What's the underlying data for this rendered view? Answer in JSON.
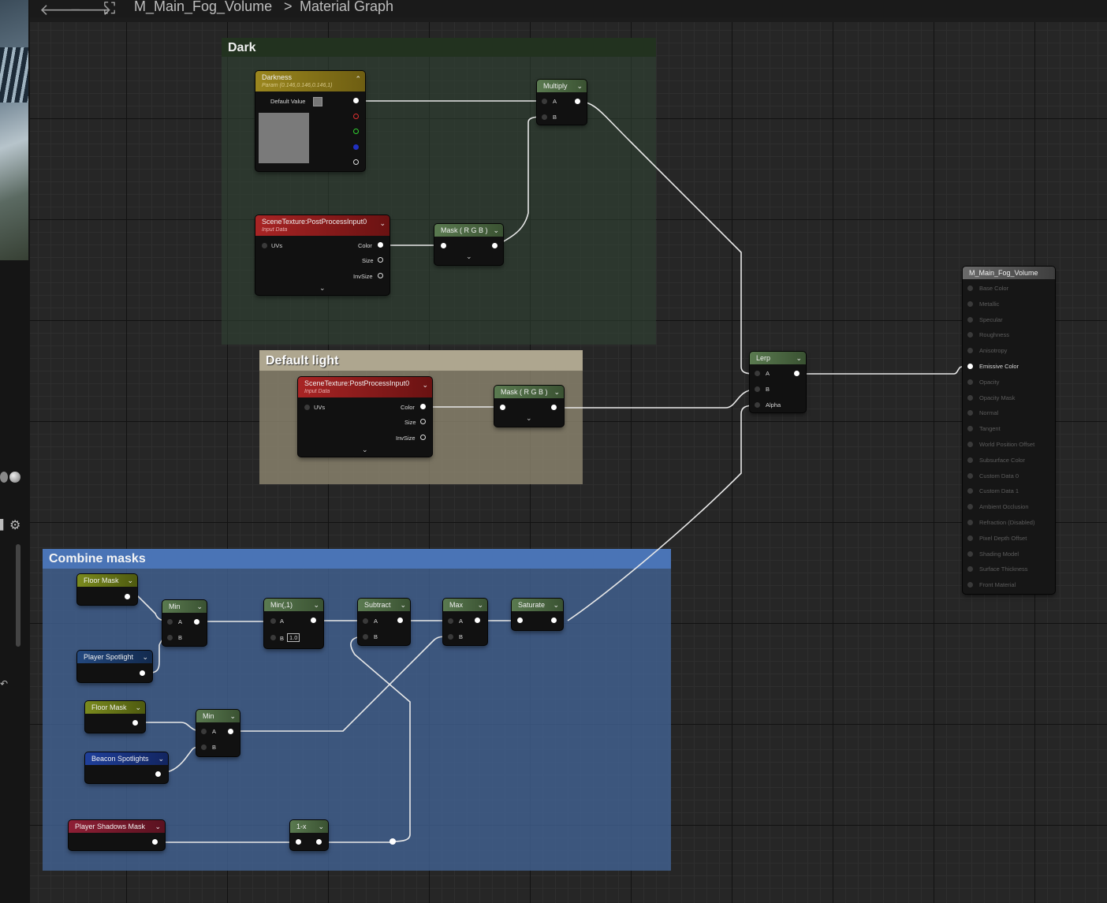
{
  "breadcrumb": {
    "asset": "M_Main_Fog_Volume",
    "separator": ">",
    "graph": "Material Graph"
  },
  "comments": {
    "dark": {
      "title": "Dark"
    },
    "default_light": {
      "title": "Default light"
    },
    "combine": {
      "title": "Combine masks"
    }
  },
  "nodes": {
    "darkness": {
      "title": "Darkness",
      "subtitle": "Param (0.146,0.146,0.146,1)",
      "default_label": "Default Value"
    },
    "scene1": {
      "title": "SceneTexture:PostProcessInput0",
      "subtitle": "Input Data",
      "uvs": "UVs",
      "color": "Color",
      "size": "Size",
      "invsize": "InvSize"
    },
    "mask1": {
      "title": "Mask ( R G B )"
    },
    "multiply": {
      "title": "Multiply",
      "a": "A",
      "b": "B"
    },
    "scene2": {
      "title": "SceneTexture:PostProcessInput0",
      "subtitle": "Input Data",
      "uvs": "UVs",
      "color": "Color",
      "size": "Size",
      "invsize": "InvSize"
    },
    "mask2": {
      "title": "Mask ( R G B )"
    },
    "lerp": {
      "title": "Lerp",
      "a": "A",
      "b": "B",
      "alpha": "Alpha"
    },
    "floor1": {
      "title": "Floor Mask"
    },
    "player_spot": {
      "title": "Player Spotlight"
    },
    "min1": {
      "title": "Min",
      "a": "A",
      "b": "B"
    },
    "min_1": {
      "title": "Min(,1)",
      "a": "A",
      "b": "B",
      "b_value": "1.0"
    },
    "subtract": {
      "title": "Subtract",
      "a": "A",
      "b": "B"
    },
    "max": {
      "title": "Max",
      "a": "A",
      "b": "B"
    },
    "saturate": {
      "title": "Saturate"
    },
    "floor2": {
      "title": "Floor Mask"
    },
    "beacon": {
      "title": "Beacon Spotlights"
    },
    "min2": {
      "title": "Min",
      "a": "A",
      "b": "B"
    },
    "shadows": {
      "title": "Player Shadows Mask"
    },
    "oneminus": {
      "title": "1-x"
    }
  },
  "result": {
    "title": "M_Main_Fog_Volume",
    "inputs": [
      "Base Color",
      "Metallic",
      "Specular",
      "Roughness",
      "Anisotropy",
      "Emissive Color",
      "Opacity",
      "Opacity Mask",
      "Normal",
      "Tangent",
      "World Position Offset",
      "Subsurface Color",
      "Custom Data 0",
      "Custom Data 1",
      "Ambient Occlusion",
      "Refraction (Disabled)",
      "Pixel Depth Offset",
      "Shading Model",
      "Surface Thickness",
      "Front Material"
    ],
    "active_input": "Emissive Color"
  },
  "colors": {
    "dark_comment": "#2d3f2f",
    "light_comment": "#8a8270",
    "combine_comment": "#3b5b8a",
    "param_header": "#8a7a1e",
    "scene_header": "#8e1f1f",
    "math_header": "#4d6b45",
    "floor_header": "#6b7a1a",
    "spot_header": "#1f3f6e",
    "shadow_header": "#7a1f2e",
    "result_header": "#5a5a5a"
  }
}
